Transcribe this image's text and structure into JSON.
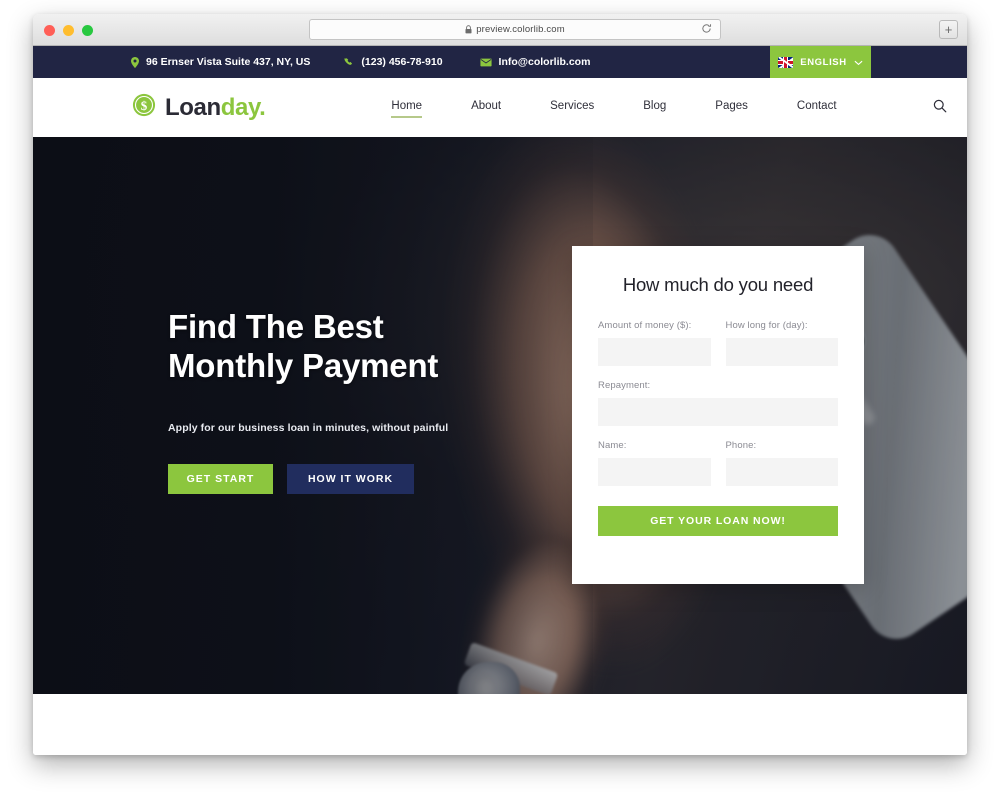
{
  "browser": {
    "url": "preview.colorlib.com",
    "lock_icon": "lock-icon",
    "reload_icon": "reload-icon",
    "newtab_label": "+"
  },
  "topbar": {
    "address": "96 Ernser Vista Suite 437, NY, US",
    "phone": "(123) 456-78-910",
    "email": "Info@colorlib.com",
    "language": "ENGLISH",
    "bg_color": "#212544",
    "accent_color": "#8CC63E"
  },
  "header": {
    "logo_primary": "Loan",
    "logo_accent": "day.",
    "nav": [
      {
        "label": "Home",
        "active": true
      },
      {
        "label": "About",
        "active": false
      },
      {
        "label": "Services",
        "active": false
      },
      {
        "label": "Blog",
        "active": false
      },
      {
        "label": "Pages",
        "active": false
      },
      {
        "label": "Contact",
        "active": false
      }
    ],
    "search_icon": "search-icon"
  },
  "hero": {
    "title": "Find The Best\nMonthly Payment",
    "subtitle": "Apply for our business loan in minutes, without painful",
    "primary_button": "GET START",
    "secondary_button": "HOW IT WORK",
    "primary_color": "#8CC63E",
    "secondary_color": "#212D5E"
  },
  "form": {
    "title": "How much do you need",
    "fields": [
      {
        "label": "Amount of money ($):",
        "value": "",
        "placeholder": ""
      },
      {
        "label": "How long for (day):",
        "value": "",
        "placeholder": ""
      },
      {
        "label": "Repayment:",
        "value": "",
        "placeholder": ""
      },
      {
        "label": "Name:",
        "value": "",
        "placeholder": ""
      },
      {
        "label": "Phone:",
        "value": "",
        "placeholder": ""
      }
    ],
    "submit_label": "GET YOUR LOAN NOW!",
    "submit_color": "#8CC63E"
  }
}
